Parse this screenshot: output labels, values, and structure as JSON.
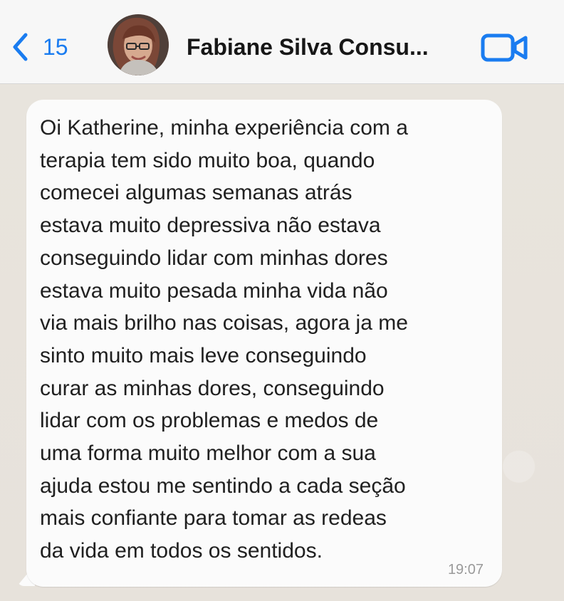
{
  "header": {
    "back_count": "15",
    "contact_name": "Fabiane Silva Consu...",
    "icons": {
      "back": "chevron-left-icon",
      "video": "video-call-icon"
    }
  },
  "message": {
    "text": "Oi Katherine, minha experiência com a\nterapia tem sido muito boa, quando\ncomecei algumas semanas atrás\nestava muito depressiva não estava\nconseguindo lidar com minhas dores\nestava muito pesada minha vida não\nvia mais brilho nas coisas, agora ja me\nsinto muito mais leve conseguindo\ncurar as minhas dores, conseguindo\nlidar com os problemas e medos de\numa forma muito melhor com a sua\najuda estou me sentindo a cada seção\nmais confiante para tomar as redeas\nda vida em todos os sentidos.",
    "time": "19:07"
  },
  "colors": {
    "accent": "#1a7cf0",
    "chat_background": "#e9e6df",
    "bubble": "#fbfbfb",
    "header": "#f7f7f7"
  }
}
